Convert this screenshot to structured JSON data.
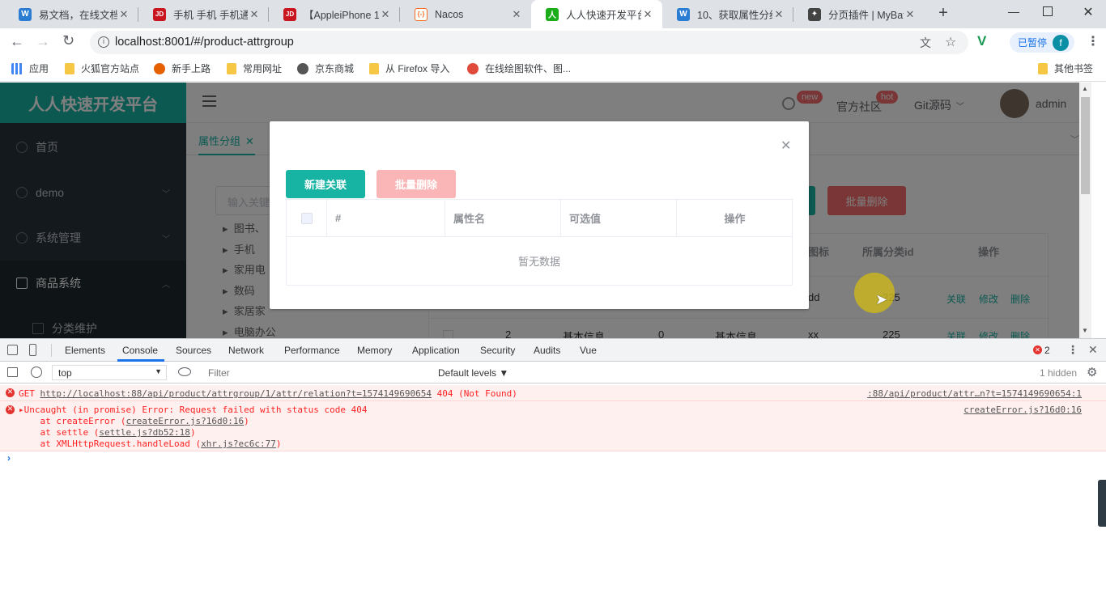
{
  "browser": {
    "tabs": [
      {
        "label": "易文档，在线文档",
        "icon": "word-doc-icon",
        "color": "#2b7cd3",
        "glyph": "W"
      },
      {
        "label": "手机 手机 手机通",
        "icon": "jd-icon",
        "color": "#c9151e",
        "glyph": "JD"
      },
      {
        "label": "【AppleiPhone 1",
        "icon": "jd-icon",
        "color": "#c9151e",
        "glyph": "JD"
      },
      {
        "label": "Nacos",
        "icon": "nacos-icon",
        "color": "#f26d21",
        "glyph": "{-}"
      },
      {
        "label": "人人快速开发平台",
        "icon": "renren-icon",
        "color": "#1aad19",
        "glyph": "人",
        "active": true
      },
      {
        "label": "10、获取属性分组",
        "icon": "word-doc-icon",
        "color": "#2b7cd3",
        "glyph": "W"
      },
      {
        "label": "分页插件 | MyBat",
        "icon": "mybatis-icon",
        "color": "#444444",
        "glyph": "🐦"
      }
    ],
    "url": "localhost:8001/#/product-attrgroup",
    "profile_label": "已暂停",
    "profile_initial": "f",
    "bookmarks": [
      {
        "label": "应用",
        "icon": "apps-grid-icon",
        "color": "#4285f4"
      },
      {
        "label": "火狐官方站点",
        "icon": "folder-icon",
        "color": "#f6c744"
      },
      {
        "label": "新手上路",
        "icon": "firefox-icon",
        "color": "#e66000"
      },
      {
        "label": "常用网址",
        "icon": "folder-icon",
        "color": "#f6c744"
      },
      {
        "label": "京东商城",
        "icon": "globe-icon",
        "color": "#555555"
      },
      {
        "label": "从 Firefox 导入",
        "icon": "folder-icon",
        "color": "#f6c744"
      },
      {
        "label": "在线绘图软件、图...",
        "icon": "processon-icon",
        "color": "#e04a3b"
      }
    ],
    "other_bookmarks": "其他书签"
  },
  "app": {
    "brand": "人人快速开发平台",
    "menu": [
      "首页",
      "demo",
      "系统管理",
      "商品系统",
      "分类维护"
    ],
    "badges": {
      "new": "new",
      "hot": "hot"
    },
    "top_links": {
      "community": "官方社区",
      "git": "Git源码",
      "user": "admin"
    },
    "page_tab": "属性分组",
    "search_placeholder": "输入关键",
    "tree": [
      "图书、",
      "手机",
      "家用电",
      "数码",
      "家居家",
      "电脑办公"
    ],
    "bg_batch_delete": "批量删除",
    "bg_headers": {
      "icon": "图标",
      "catelog": "所属分类id",
      "ops": "操作"
    },
    "bg_rows": [
      {
        "id": "",
        "name": "",
        "sort": "",
        "desc": "",
        "icon": "dd",
        "catelog": "225"
      },
      {
        "id": "2",
        "name": "基本信息",
        "sort": "0",
        "desc": "基本信息",
        "icon": "xx",
        "catelog": "225"
      }
    ],
    "row_actions": {
      "relate": "关联",
      "edit": "修改",
      "delete": "删除"
    }
  },
  "dialog": {
    "new_relation": "新建关联",
    "batch_delete": "批量删除",
    "columns": {
      "index": "#",
      "attr_name": "属性名",
      "values": "可选值",
      "ops": "操作"
    },
    "empty": "暂无数据"
  },
  "devtools": {
    "tabs": [
      "Elements",
      "Console",
      "Sources",
      "Network",
      "Performance",
      "Memory",
      "Application",
      "Security",
      "Audits",
      "Vue"
    ],
    "active_tab": "Console",
    "error_count": "2",
    "context": "top",
    "filter_placeholder": "Filter",
    "levels": "Default levels ▼",
    "hidden": "1 hidden",
    "logs": {
      "get_prefix": "GET ",
      "get_url": "http://localhost:88/api/product/attrgroup/1/attr/relation?t=1574149690654",
      "get_status": " 404 (Not Found)",
      "get_source": ":88/api/product/attr…n?t=1574149690654:1",
      "uncaught": "Uncaught (in promise) Error: Request failed with status code 404",
      "uncaught_source": "createError.js?16d0:16",
      "stack": [
        {
          "pre": "    at createError (",
          "link": "createError.js?16d0:16",
          "post": ")"
        },
        {
          "pre": "    at settle (",
          "link": "settle.js?db52:18",
          "post": ")"
        },
        {
          "pre": "    at XMLHttpRequest.handleLoad (",
          "link": "xhr.js?ec6c:77",
          "post": ")"
        }
      ]
    }
  },
  "colors": {
    "accent": "#17b3a3",
    "danger_light": "#fab6b6",
    "sidebar": "#263238",
    "error": "#fe2222"
  }
}
